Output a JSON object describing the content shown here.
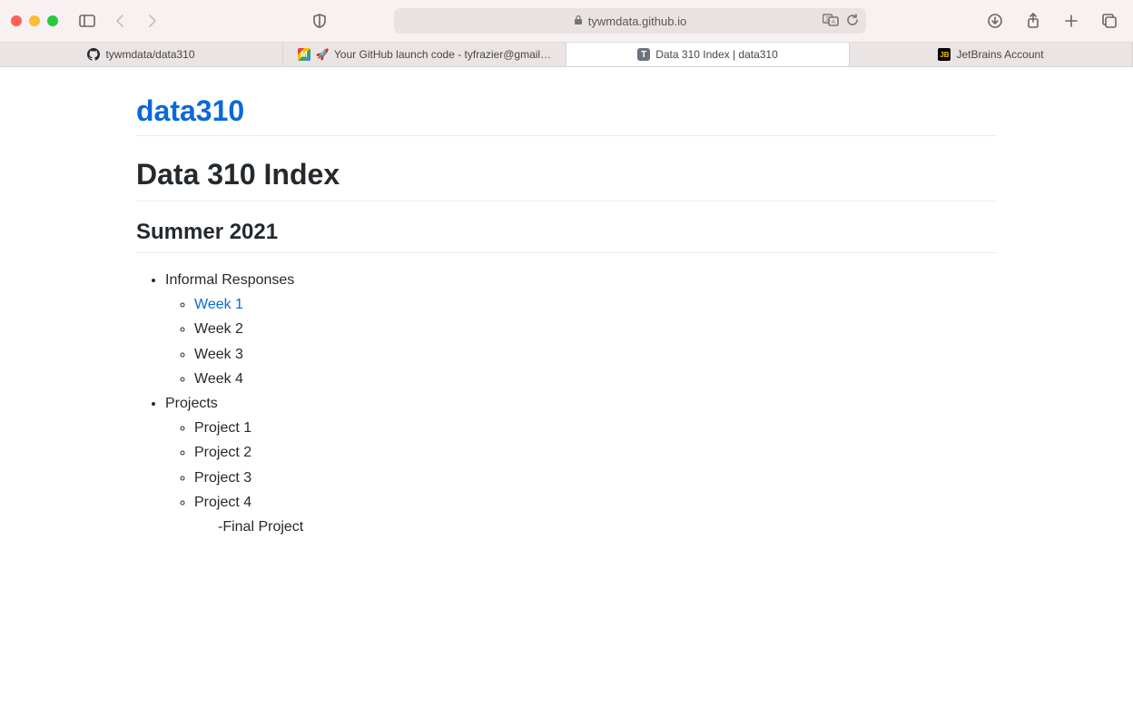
{
  "address_bar": {
    "host": "tywmdata.github.io"
  },
  "tabs": [
    {
      "label": "tywmdata/data310"
    },
    {
      "label": "Your GitHub launch code - tyfrazier@gmail…"
    },
    {
      "label": "Data 310 Index | data310"
    },
    {
      "label": "JetBrains Account"
    }
  ],
  "page": {
    "site_title": "data310",
    "h1": "Data 310 Index",
    "h2": "Summer 2021",
    "section1_label": "Informal Responses",
    "weeks": [
      "Week 1",
      "Week 2",
      "Week 3",
      "Week 4"
    ],
    "section2_label": "Projects",
    "projects": [
      "Project 1",
      "Project 2",
      "Project 3",
      "Project 4"
    ],
    "final_line": "-Final Project"
  }
}
